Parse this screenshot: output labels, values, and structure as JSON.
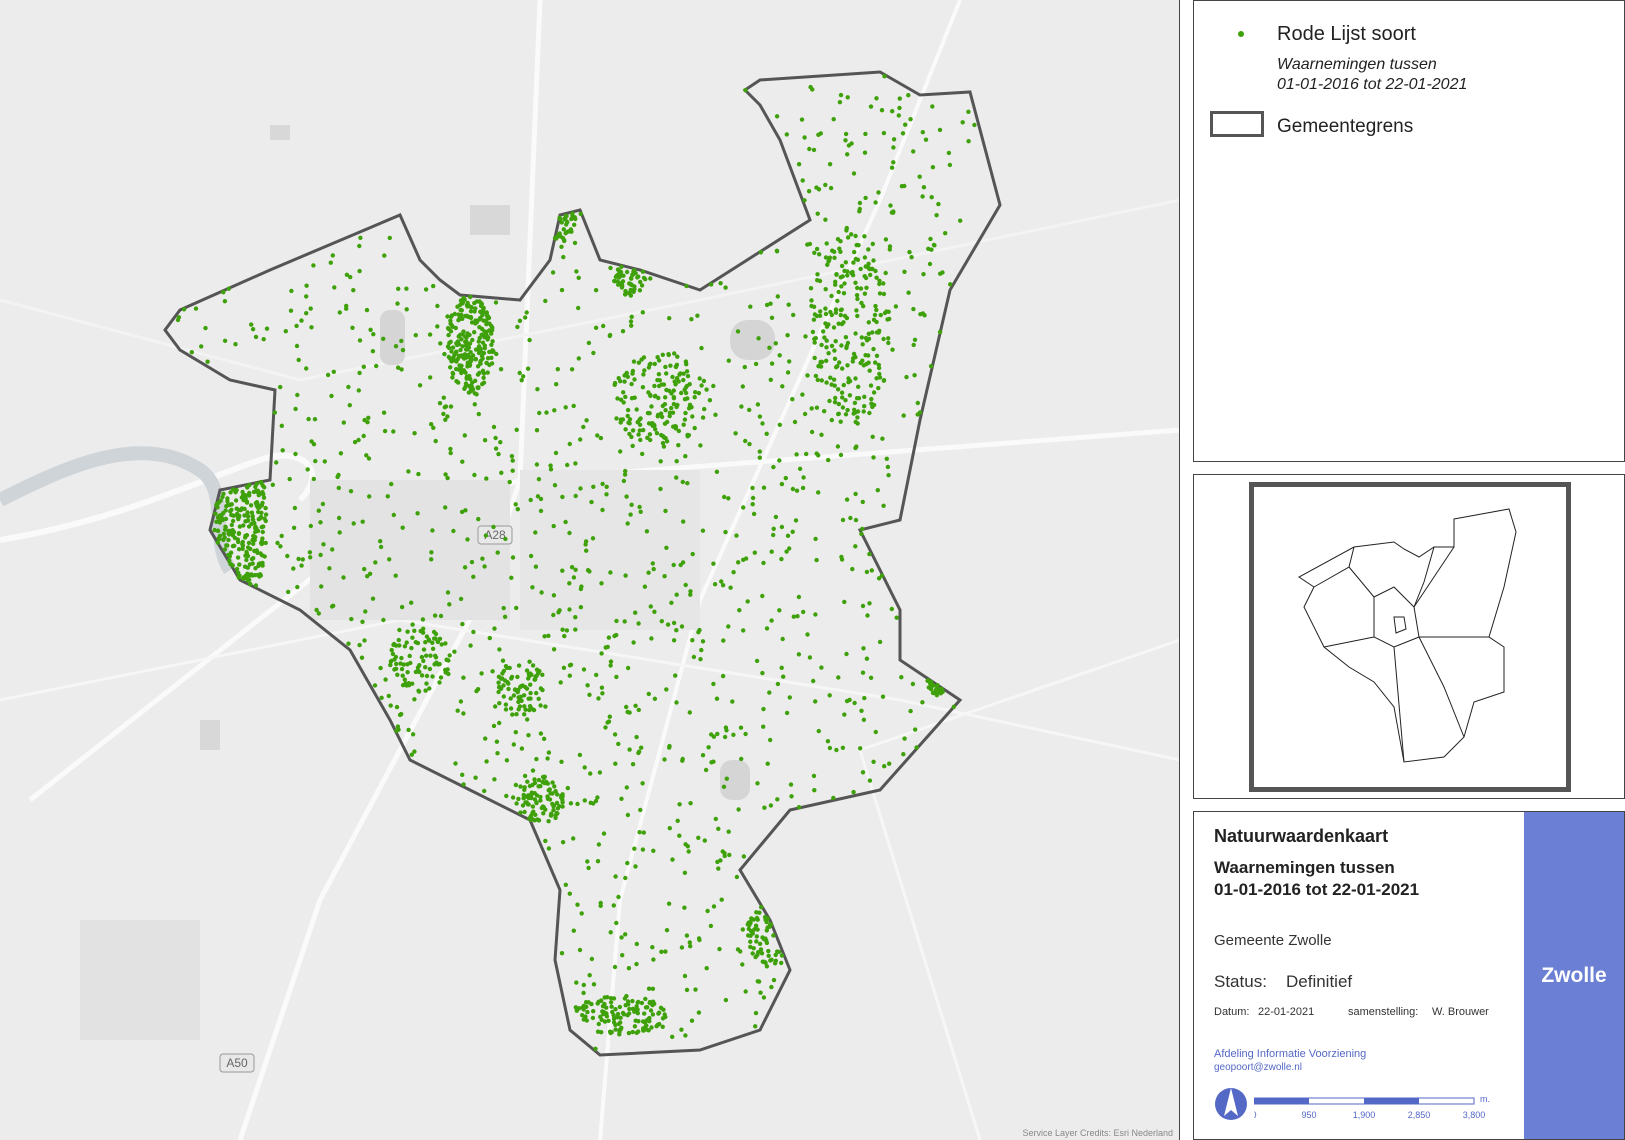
{
  "map": {
    "road_labels": [
      "A28",
      "A50"
    ],
    "credits": "Service Layer Credits: Esri Nederland",
    "basemap_color": "#ececec",
    "boundary_color": "#555555",
    "observation_color": "#3fa10a"
  },
  "legend": {
    "point_label": "Rode Lijst soort",
    "point_sub_line1": "Waarnemingen tussen",
    "point_sub_line2": "01-01-2016 tot 22-01-2021",
    "boundary_label": "Gemeentegrens"
  },
  "title_block": {
    "title": "Natuurwaardenkaart",
    "subtitle_line1": "Waarnemingen tussen",
    "subtitle_line2": "01-01-2016 tot 22-01-2021",
    "organization": "Gemeente Zwolle",
    "status_label": "Status:",
    "status_value": "Definitief",
    "date_label": "Datum:",
    "date_value": "22-01-2021",
    "author_label": "samenstelling:",
    "author_value": "W. Brouwer",
    "department": "Afdeling Informatie Voorziening",
    "email": "geopoort@zwolle.nl",
    "brand": "Zwolle",
    "brand_color": "#6b7fd4",
    "scale_labels": [
      "0",
      "950",
      "1,900",
      "2,850",
      "3,800"
    ],
    "scale_unit": "m."
  }
}
